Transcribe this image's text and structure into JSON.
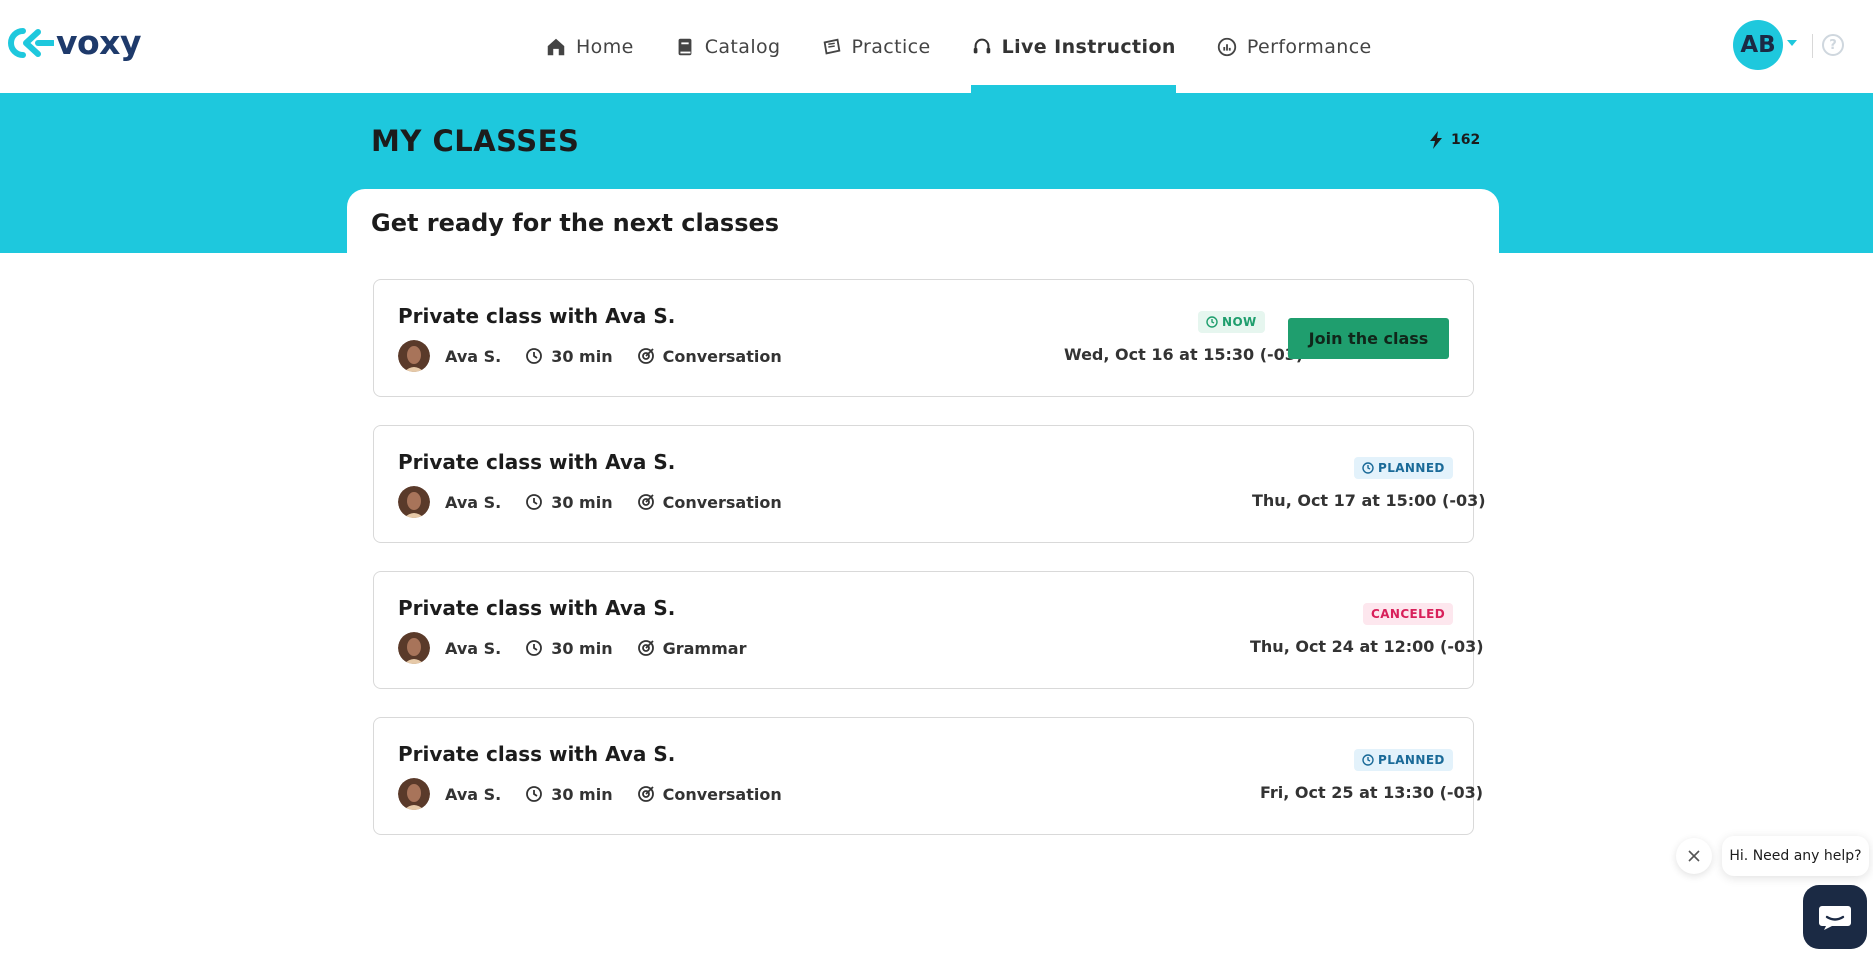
{
  "brand": {
    "name": "voxy"
  },
  "nav": {
    "items": [
      {
        "label": "Home",
        "icon": "home-icon",
        "active": false
      },
      {
        "label": "Catalog",
        "icon": "book-icon",
        "active": false
      },
      {
        "label": "Practice",
        "icon": "practice-icon",
        "active": false
      },
      {
        "label": "Live Instruction",
        "icon": "headset-icon",
        "active": true
      },
      {
        "label": "Performance",
        "icon": "performance-icon",
        "active": false
      }
    ],
    "user_initials": "AB",
    "help_icon": "help-icon"
  },
  "page": {
    "title": "MY CLASSES",
    "points": "162",
    "section_title": "Get ready for the next classes"
  },
  "classes": [
    {
      "title": "Private class with Ava S.",
      "teacher": "Ava S.",
      "duration": "30 min",
      "topic": "Conversation",
      "status": "NOW",
      "datetime": "Wed, Oct 16 at 15:30 (-03)",
      "action": "Join the class"
    },
    {
      "title": "Private class with Ava S.",
      "teacher": "Ava S.",
      "duration": "30 min",
      "topic": "Conversation",
      "status": "PLANNED",
      "datetime": "Thu, Oct 17 at 15:00 (-03)"
    },
    {
      "title": "Private class with Ava S.",
      "teacher": "Ava S.",
      "duration": "30 min",
      "topic": "Grammar",
      "status": "CANCELED",
      "datetime": "Thu, Oct 24 at 12:00 (-03)"
    },
    {
      "title": "Private class with Ava S.",
      "teacher": "Ava S.",
      "duration": "30 min",
      "topic": "Conversation",
      "status": "PLANNED",
      "datetime": "Fri, Oct 25 at 13:30 (-03)"
    }
  ],
  "chat": {
    "prompt": "Hi. Need any help?"
  },
  "colors": {
    "accent": "#1ec8dd",
    "brand_dark": "#1e3a6b",
    "join_green": "#1f9e6e",
    "now_green": "#1e9e6d",
    "planned_blue": "#1a6a98",
    "canceled_pink": "#d8205a"
  }
}
